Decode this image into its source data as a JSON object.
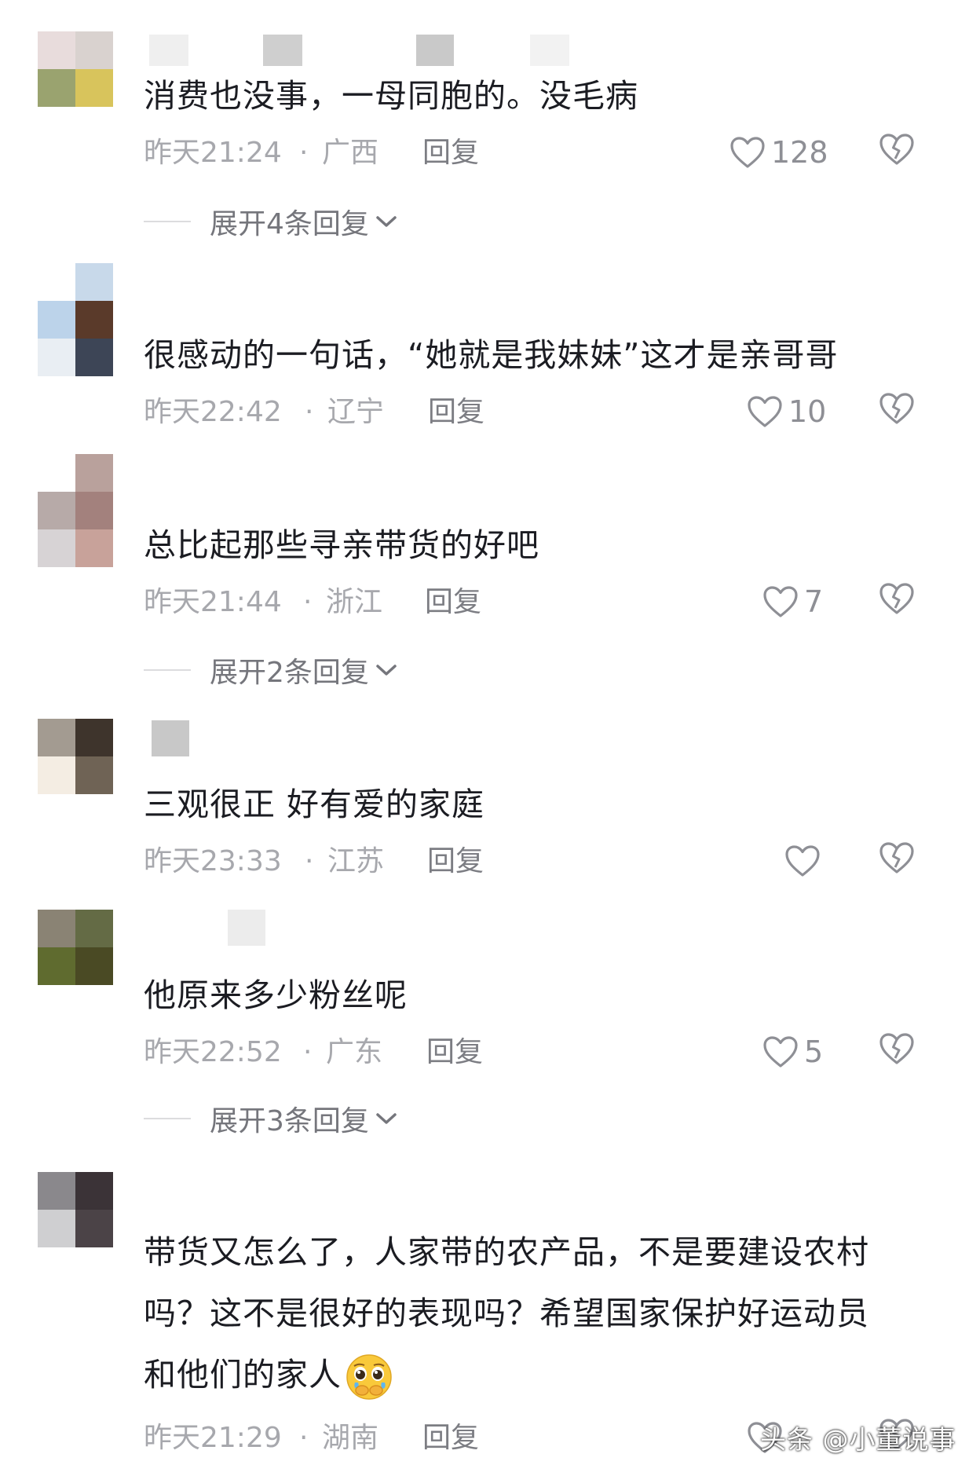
{
  "comments": [
    {
      "text": "消费也没事，一母同胞的。没毛病",
      "time": "昨天21:24",
      "location": "广西",
      "reply_label": "回复",
      "likes": "128",
      "expand_label": "展开4条回复"
    },
    {
      "text": "很感动的一句话，“她就是我妹妹”这才是亲哥哥",
      "time": "昨天22:42",
      "location": "辽宁",
      "reply_label": "回复",
      "likes": "10"
    },
    {
      "text": "总比起那些寻亲带货的好吧",
      "time": "昨天21:44",
      "location": "浙江",
      "reply_label": "回复",
      "likes": "7",
      "expand_label": "展开2条回复"
    },
    {
      "text": "三观很正 好有爱的家庭",
      "time": "昨天23:33",
      "location": "江苏",
      "reply_label": "回复",
      "likes": ""
    },
    {
      "text": "他原来多少粉丝呢",
      "time": "昨天22:52",
      "location": "广东",
      "reply_label": "回复",
      "likes": "5",
      "expand_label": "展开3条回复"
    },
    {
      "text_lines": [
        "带货又怎么了，人家带的农产品，不是要建设农村",
        "吗？这不是很好的表现吗？希望国家保护好运动员",
        "和他们的家人"
      ],
      "emoji_icon": "pleading-face-icon",
      "time": "昨天21:29",
      "location": "湖南",
      "reply_label": "回复"
    }
  ],
  "separator": "·",
  "watermark": "头条 @小董说事",
  "colors": {
    "text": "#1b1c22",
    "meta": "#a7a8ad",
    "reply": "#7c7d83",
    "icon": "#8e8f95"
  }
}
